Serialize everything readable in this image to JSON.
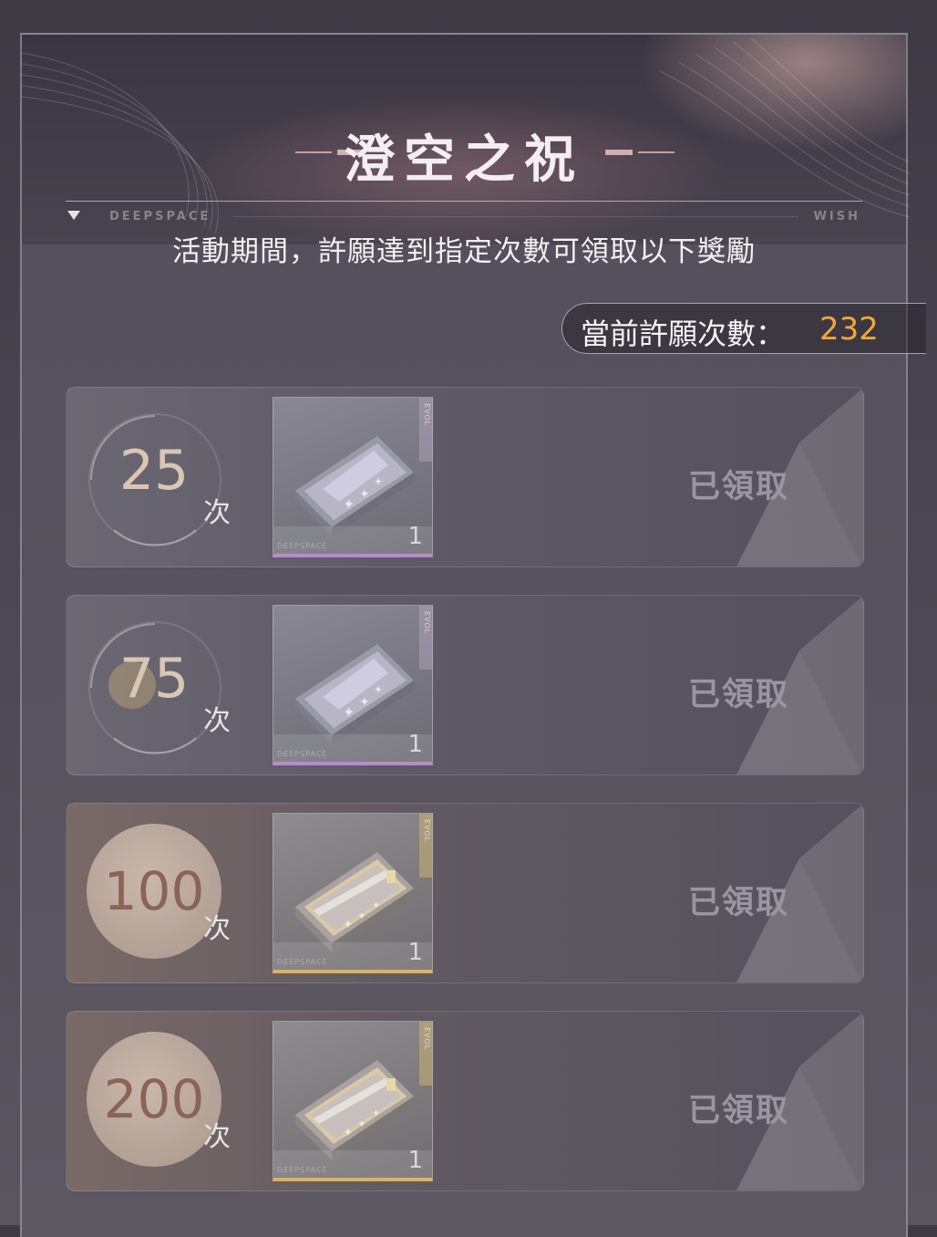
{
  "header": {
    "title": "澄空之祝",
    "left_tag": "DEEPSPACE",
    "right_tag": "WISH",
    "subtitle": "活動期間，許願達到指定次數可領取以下獎勵"
  },
  "wish_count": {
    "label": "當前許願次數：",
    "value": "232",
    "value_color": "#f2a63c"
  },
  "milestones": [
    {
      "count": "25",
      "unit": "次",
      "reward_qty": "1",
      "reward_brand": "EVOL",
      "reward_footer": "DEEPSPACE",
      "status": "已領取",
      "tier": "purple"
    },
    {
      "count": "75",
      "unit": "次",
      "reward_qty": "1",
      "reward_brand": "EVOL",
      "reward_footer": "DEEPSPACE",
      "status": "已領取",
      "tier": "purple"
    },
    {
      "count": "100",
      "unit": "次",
      "reward_qty": "1",
      "reward_brand": "EVOL",
      "reward_footer": "DEEPSPACE",
      "status": "已領取",
      "tier": "gold"
    },
    {
      "count": "200",
      "unit": "次",
      "reward_qty": "1",
      "reward_brand": "EVOL",
      "reward_footer": "DEEPSPACE",
      "status": "已領取",
      "tier": "gold"
    }
  ],
  "colors": {
    "purple_tier": "#b48ec8",
    "gold_tier": "#d9b45e",
    "claimed_text": "#9a959e"
  },
  "icons": {
    "reward_item": "gift-box-icon",
    "section_marker": "triangle-down-icon"
  }
}
